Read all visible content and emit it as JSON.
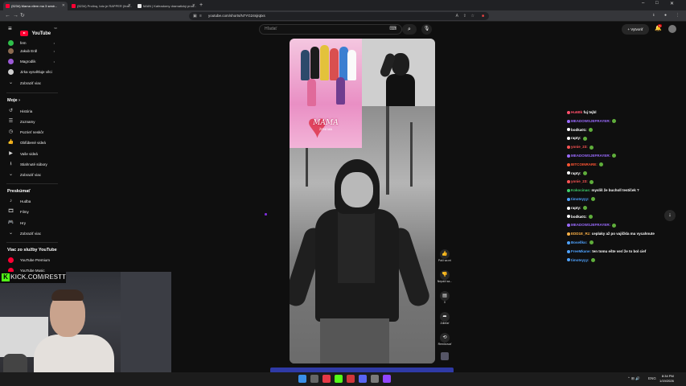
{
  "browser": {
    "tabs": [
      {
        "label": "(5234) Mama vilem ma 3 sestr...",
        "favicon": "youtube-icon"
      },
      {
        "label": "(5234) Prolinq, toto je RAPPER (feat...",
        "favicon": "youtube-icon"
      },
      {
        "label": "MAIN | Kafeadomy dramatický prod...",
        "favicon": "page-icon"
      }
    ],
    "new_tab": "+",
    "url": "youtube.com/shorts/N7YG24sjrqtxs",
    "window_controls": [
      "–",
      "□",
      "✕"
    ]
  },
  "header": {
    "logo_text": "YouTube",
    "logo_country": "SK",
    "search_placeholder": "Hľadať",
    "create_label": "Vytvoriť",
    "notifications_count": "9+"
  },
  "sidebar": {
    "subscriptions": [
      {
        "label": "fem",
        "color": "#2fbf4a"
      },
      {
        "label": "Jakub Erdl",
        "color": "#8b6a50"
      },
      {
        "label": "Magrodlik",
        "color": "#9b59d6"
      },
      {
        "label": "Jirka vysvětluje věci",
        "color": "#d0d0d0"
      }
    ],
    "show_more_1": "Zobraziť viac",
    "my_section_title": "Moje",
    "my_items": [
      "História",
      "Zoznamy",
      "Pozrieť neskôr",
      "Obľúbené videá",
      "Vaše videá",
      "Stiahnuté súbory",
      "Zobraziť viac"
    ],
    "explore_title": "Preskúmať",
    "explore_items": [
      "Hudba",
      "Filmy",
      "Hry",
      "Zobraziť viac"
    ],
    "more_title": "Viac zo služby YouTube",
    "more_items": [
      "YouTube Premium",
      "YouTube Music"
    ]
  },
  "short": {
    "show_title": "MAMA",
    "show_subtitle": "ŽENÍ MA"
  },
  "actions": {
    "like_label": "Páči sa mi",
    "dislike_label": "Nepáči sa...",
    "comments_count": "0",
    "share_label": "Zdieľať",
    "remix_label": "Remixovať"
  },
  "chat": [
    {
      "user": "Hu6Bk",
      "text": "fuj tejbl",
      "color": "#ff4f6b"
    },
    {
      "user": "MEADOWSJEFRAYER:",
      "text": "",
      "color": "#9b6bff"
    },
    {
      "user": "bodka01:",
      "text": "",
      "color": "#ffffff"
    },
    {
      "user": "rapty:",
      "text": "",
      "color": "#ffffff"
    },
    {
      "user": "yonie_23:",
      "text": "",
      "color": "#ff5555"
    },
    {
      "user": "MEADOWSJEFRAYER:",
      "text": "",
      "color": "#9b6bff"
    },
    {
      "user": "BITCOINRARE:",
      "text": "",
      "color": "#ff5533"
    },
    {
      "user": "rapty:",
      "text": "",
      "color": "#ffffff"
    },
    {
      "user": "yonie_23:",
      "text": "",
      "color": "#ff5555"
    },
    {
      "user": "Kokocinas:",
      "text": "myslíš že bucholl testíček ?",
      "color": "#3fd06a"
    },
    {
      "user": "timoteyyy:",
      "text": "",
      "color": "#4fa3ff"
    },
    {
      "user": "rapty:",
      "text": "",
      "color": "#ffffff"
    },
    {
      "user": "bodka01:",
      "text": "",
      "color": "#ffffff"
    },
    {
      "user": "MEADOWSJEFRAYER:",
      "text": "",
      "color": "#9b6bff"
    },
    {
      "user": "EDD1E_Rz:",
      "text": "ceplaky až po vajíčkla ma vycahnute",
      "color": "#ffb347"
    },
    {
      "user": "Bosellko:",
      "text": "",
      "color": "#4fa3ff"
    },
    {
      "user": "FreeMkane:",
      "text": "ten tomu ešte verí že to bol cief",
      "color": "#4fa3ff"
    },
    {
      "user": "timoteyyy:",
      "text": "",
      "color": "#4fa3ff"
    }
  ],
  "stream": {
    "kick_url": "KICK.COM/RESTT",
    "kick_logo": "K"
  },
  "taskbar": {
    "time": "8:34 PM",
    "date": "1/19/2026",
    "tray_lang": "ENG"
  }
}
